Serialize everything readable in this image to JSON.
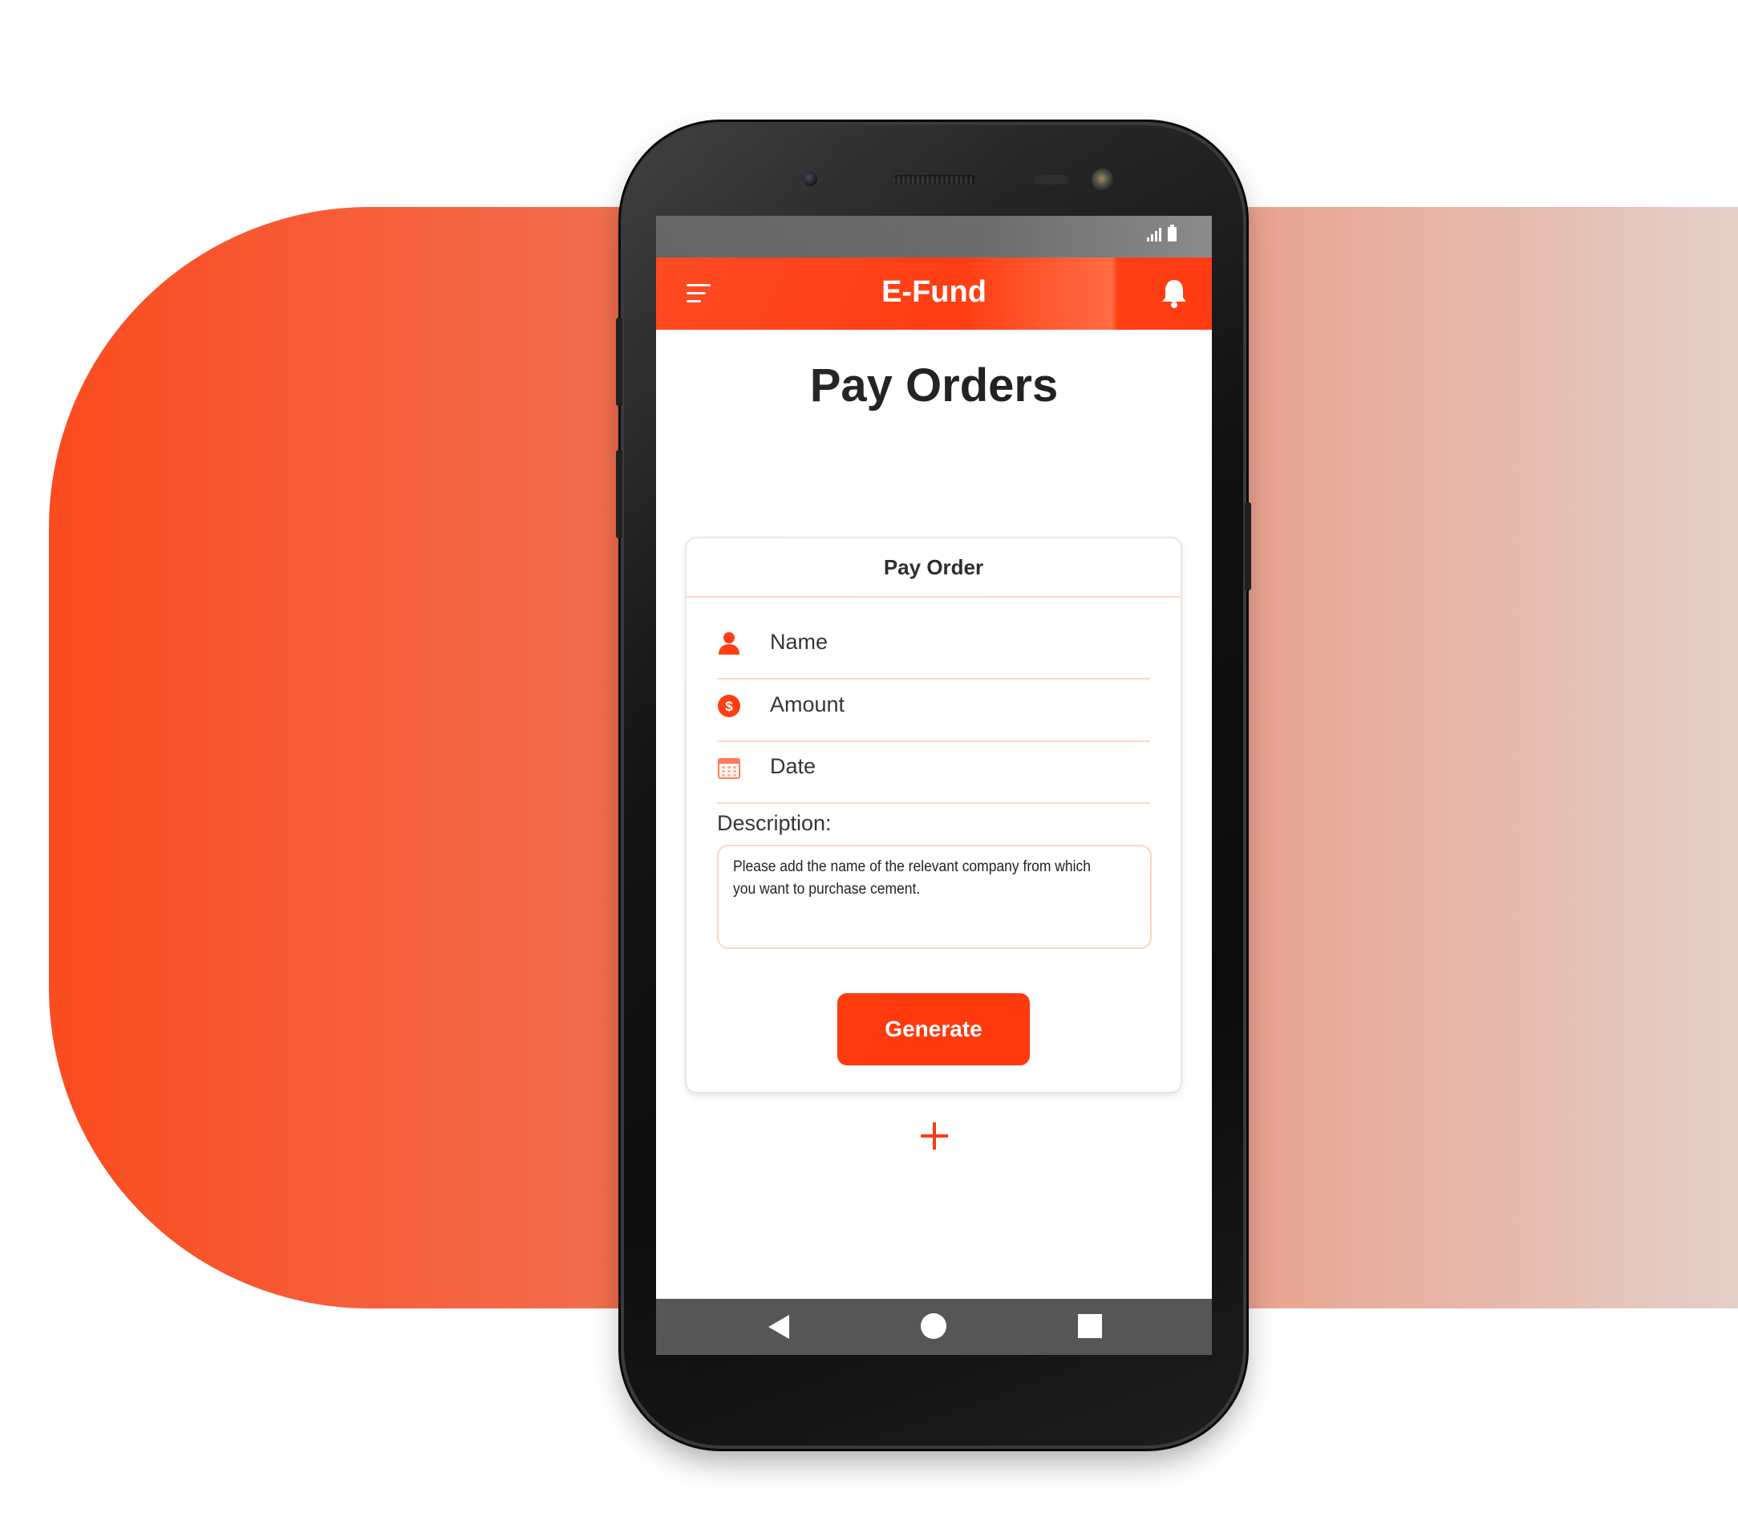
{
  "app": {
    "title": "E-Fund",
    "accent_color": "#ff3a0f"
  },
  "status_bar": {
    "icons": [
      "signal-icon",
      "battery-icon"
    ]
  },
  "app_bar": {
    "menu_icon": "hamburger-menu-icon",
    "notification_icon": "bell-icon"
  },
  "page": {
    "title": "Pay Orders"
  },
  "card": {
    "header": "Pay Order",
    "fields": [
      {
        "icon": "user-icon",
        "label": "Name"
      },
      {
        "icon": "dollar-icon",
        "label": "Amount"
      },
      {
        "icon": "calendar-icon",
        "label": "Date"
      }
    ],
    "description_label": "Description:",
    "description_text": "Please add the name of the relevant company from which you want to purchase cement.",
    "generate_label": "Generate"
  },
  "add_button": {
    "icon": "plus-icon"
  },
  "nav_bar": {
    "icons": [
      "back-icon",
      "home-icon",
      "recent-apps-icon"
    ]
  }
}
